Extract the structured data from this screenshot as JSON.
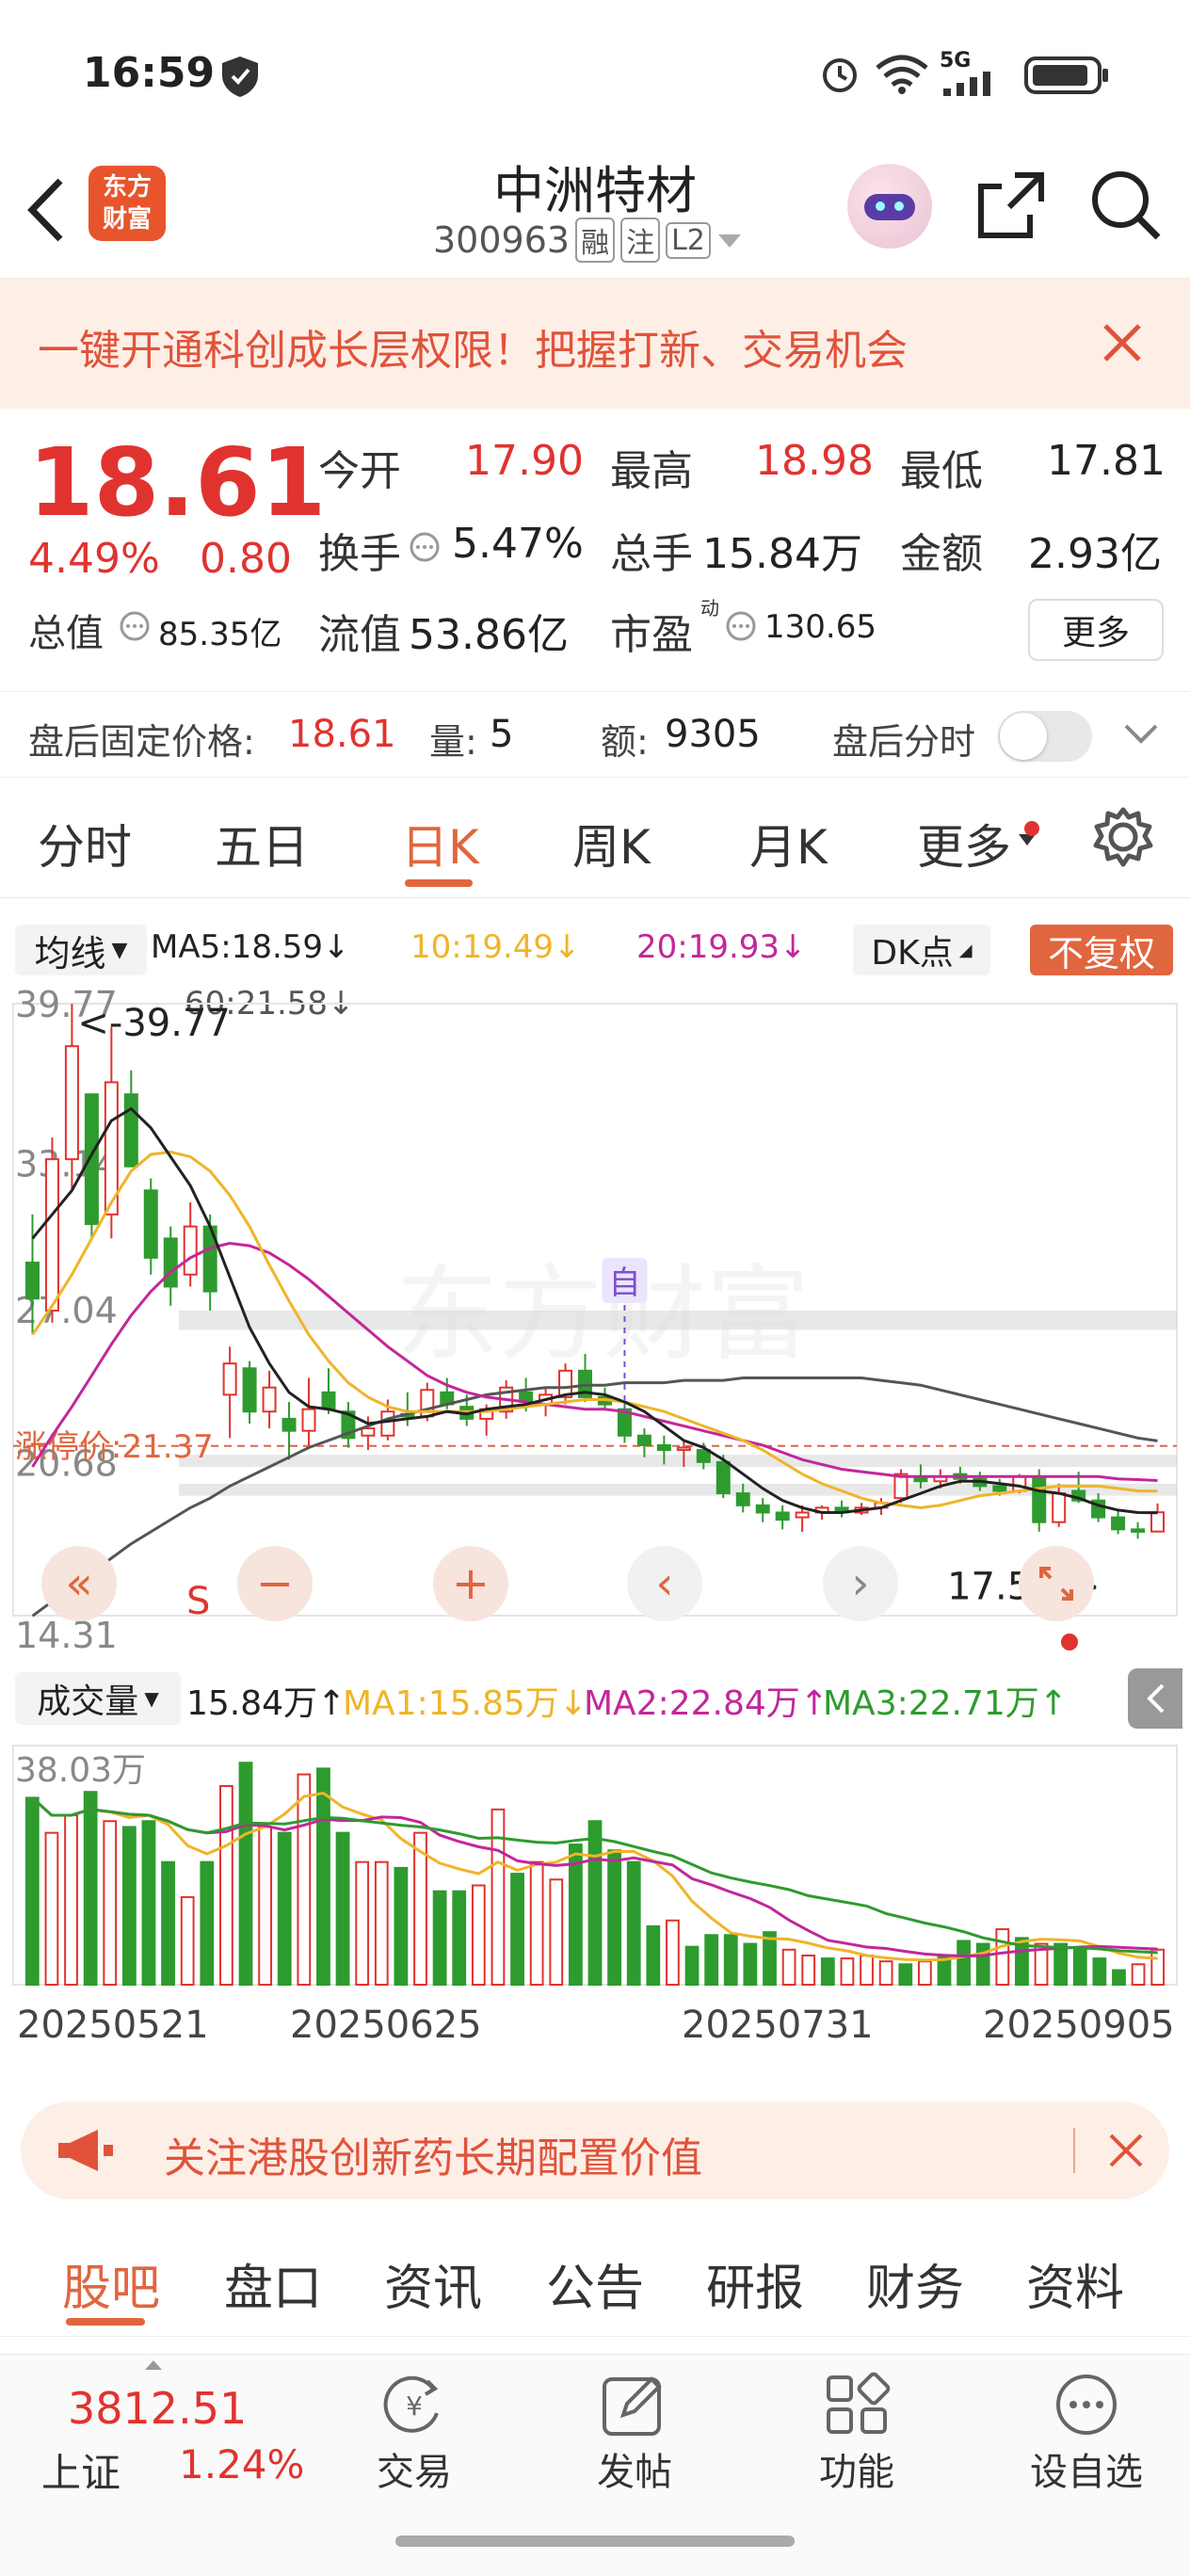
{
  "status": {
    "time": "16:59",
    "net": "5G"
  },
  "header": {
    "name": "中洲特材",
    "code": "300963",
    "tags": [
      "融",
      "注",
      "L2"
    ],
    "logo_lines": [
      "东方",
      "财富"
    ]
  },
  "promo": {
    "text": "一键开通科创成长层权限！把握打新、交易机会"
  },
  "quote": {
    "price": "18.61",
    "pct": "4.49%",
    "chg": "0.80",
    "open_l": "今开",
    "open": "17.90",
    "high_l": "最高",
    "high": "18.98",
    "low_l": "最低",
    "low": "17.81",
    "turn_l": "换手",
    "turn": "5.47%",
    "vol_l": "总手",
    "vol": "15.84万",
    "amt_l": "金额",
    "amt": "2.93亿",
    "mcap_l": "总值",
    "mcap": "85.35亿",
    "flt_l": "流值",
    "flt": "53.86亿",
    "pe_l": "市盈",
    "pe_sup": "动",
    "pe": "130.65",
    "more": "更多"
  },
  "after": {
    "price_l": "盘后固定价格:",
    "price": "18.61",
    "vol_l": "量:",
    "vol": "5",
    "amt_l": "额:",
    "amt": "9305",
    "tl_l": "盘后分时"
  },
  "tabs": [
    "分时",
    "五日",
    "日K",
    "周K",
    "月K",
    "更多"
  ],
  "ma": {
    "btn": "均线",
    "ma5": "MA5:18.59↓",
    "ma10": "10:19.49↓",
    "ma20": "20:19.93↓",
    "ma60": "60:21.58↓",
    "dk": "DK点",
    "fq": "不复权"
  },
  "colors": {
    "up": "#e0332f",
    "down": "#2e9b2e",
    "ma5": "#222222",
    "ma10": "#f0b429",
    "ma20": "#c2279a",
    "ma60": "#555555",
    "accent": "#e0663f"
  },
  "chart_labels": {
    "y_top": "39.77",
    "y_mid": "33.14",
    "y_27": "27.04",
    "y_20": "20.68",
    "y_low": "14.31",
    "max_mark": "<-39.77",
    "min_mark": "17.51->",
    "limit": "涨停价:21.37",
    "auto": "自",
    "s_mark": "S",
    "watermark": "东方财富"
  },
  "chart_data": [
    {
      "type": "candlestick",
      "title": "日K",
      "ylim": [
        14.31,
        39.77
      ],
      "ohlc": [
        [
          29,
          31,
          26,
          27.5
        ],
        [
          27,
          34.2,
          26.5,
          33.3
        ],
        [
          33.3,
          39.77,
          32,
          38
        ],
        [
          36,
          36,
          30,
          30.6
        ],
        [
          31,
          38.8,
          30,
          36.5
        ],
        [
          36,
          37,
          33,
          33
        ],
        [
          32,
          32.5,
          28.5,
          29.2
        ],
        [
          30,
          30.5,
          27.2,
          28
        ],
        [
          28.5,
          31.5,
          28,
          30.5
        ],
        [
          30.5,
          31,
          27,
          27.8
        ],
        [
          23.5,
          25.5,
          21.7,
          24.8
        ],
        [
          24.6,
          24.9,
          22.3,
          22.8
        ],
        [
          22.8,
          24.5,
          22.1,
          23.8
        ],
        [
          22.5,
          23.2,
          20.8,
          22
        ],
        [
          22,
          24.2,
          21.4,
          22.9
        ],
        [
          23.6,
          24.6,
          22.7,
          22.9
        ],
        [
          22.8,
          23.2,
          21.3,
          21.7
        ],
        [
          21.8,
          22.6,
          21.2,
          22.1
        ],
        [
          21.8,
          23.3,
          21.6,
          22.8
        ],
        [
          22.7,
          23.6,
          22.2,
          22.6
        ],
        [
          22.6,
          24,
          22.4,
          23.7
        ],
        [
          23.6,
          24.2,
          22.9,
          23.1
        ],
        [
          23,
          23.5,
          22.2,
          22.5
        ],
        [
          22.5,
          23.1,
          21.8,
          22.9
        ],
        [
          22.8,
          24.1,
          22.5,
          23.8
        ],
        [
          23.6,
          24.2,
          22.8,
          23.2
        ],
        [
          23.1,
          23.8,
          22.6,
          23.5
        ],
        [
          23.4,
          24.8,
          23.1,
          24.5
        ],
        [
          24.5,
          25.2,
          23.2,
          23.4
        ],
        [
          23.4,
          23.8,
          22.9,
          23.1
        ],
        [
          22.9,
          23.2,
          21.5,
          21.8
        ],
        [
          21.8,
          22.1,
          20.9,
          21.4
        ],
        [
          21.4,
          21.8,
          20.6,
          21.2
        ],
        [
          21.2,
          21.6,
          20.5,
          21.3
        ],
        [
          21.2,
          21.5,
          20.4,
          20.7
        ],
        [
          20.7,
          21,
          19.2,
          19.4
        ],
        [
          19.4,
          19.8,
          18.6,
          18.9
        ],
        [
          18.9,
          19.2,
          18.2,
          18.6
        ],
        [
          18.6,
          18.9,
          17.9,
          18.3
        ],
        [
          18.4,
          18.9,
          17.8,
          18.6
        ],
        [
          18.6,
          18.9,
          18.3,
          18.8
        ],
        [
          18.8,
          19.1,
          18.4,
          18.6
        ],
        [
          18.6,
          19,
          18.5,
          18.8
        ],
        [
          18.8,
          19.2,
          18.5,
          19
        ],
        [
          19.2,
          20.4,
          19,
          20.2
        ],
        [
          20.1,
          20.6,
          19.6,
          19.9
        ],
        [
          19.9,
          20.4,
          19.6,
          20.1
        ],
        [
          20.2,
          20.5,
          19.8,
          20
        ],
        [
          20,
          20.3,
          19.5,
          19.7
        ],
        [
          19.7,
          20,
          19.3,
          19.5
        ],
        [
          19.5,
          20.2,
          19.4,
          20.1
        ],
        [
          20.1,
          20.4,
          17.8,
          18.2
        ],
        [
          18.2,
          19.8,
          18,
          19.4
        ],
        [
          19.5,
          20.3,
          19,
          19.1
        ],
        [
          19.1,
          19.4,
          18.2,
          18.4
        ],
        [
          18.4,
          18.7,
          17.7,
          17.9
        ],
        [
          17.9,
          18.2,
          17.51,
          17.8
        ],
        [
          17.81,
          18.98,
          17.81,
          18.61
        ]
      ],
      "ma5": [
        30,
        31,
        32,
        33.5,
        34.9,
        35.4,
        34.6,
        33.4,
        32.2,
        30.5,
        28.4,
        26.3,
        24.8,
        23.6,
        23,
        22.9,
        22.7,
        22.3,
        22.4,
        22.5,
        22.6,
        22.8,
        22.7,
        22.9,
        23,
        23.1,
        23.3,
        23.5,
        23.6,
        23.5,
        23.2,
        22.8,
        22.2,
        21.6,
        21.3,
        20.8,
        20.2,
        19.6,
        19.1,
        18.8,
        18.6,
        18.6,
        18.7,
        18.8,
        19.1,
        19.4,
        19.7,
        19.9,
        19.9,
        19.8,
        19.7,
        19.5,
        19.4,
        19.2,
        18.9,
        18.7,
        18.6,
        18.59
      ],
      "ma10": [
        26,
        27.2,
        28.5,
        30,
        31.5,
        32.8,
        33.5,
        33.6,
        33.4,
        32.8,
        31.8,
        30.5,
        28.9,
        27.4,
        26,
        24.9,
        24,
        23.4,
        23,
        22.8,
        22.8,
        22.8,
        22.8,
        22.8,
        22.9,
        23,
        23.1,
        23.2,
        23.3,
        23.3,
        23.2,
        23,
        22.8,
        22.5,
        22.2,
        21.9,
        21.6,
        21.2,
        20.7,
        20.2,
        19.8,
        19.5,
        19.2,
        19,
        18.9,
        18.8,
        18.9,
        19.1,
        19.3,
        19.4,
        19.5,
        19.6,
        19.7,
        19.7,
        19.7,
        19.6,
        19.5,
        19.49
      ],
      "ma20": [
        20.5,
        21.8,
        23,
        24.3,
        25.6,
        26.8,
        27.8,
        28.6,
        29.2,
        29.6,
        29.8,
        29.7,
        29.4,
        28.9,
        28.3,
        27.6,
        26.9,
        26.2,
        25.5,
        24.9,
        24.3,
        23.9,
        23.6,
        23.4,
        23.3,
        23.2,
        23.1,
        23,
        22.9,
        22.9,
        22.8,
        22.6,
        22.4,
        22.2,
        22,
        21.8,
        21.6,
        21.4,
        21.1,
        20.8,
        20.6,
        20.4,
        20.3,
        20.2,
        20.1,
        20.1,
        20.1,
        20.1,
        20.1,
        20.1,
        20.1,
        20.1,
        20.1,
        20.1,
        20.1,
        20,
        19.97,
        19.93
      ],
      "ma60": [
        14.3,
        14.9,
        15.5,
        16.1,
        16.7,
        17.3,
        17.8,
        18.3,
        18.8,
        19.2,
        19.7,
        20.1,
        20.5,
        20.9,
        21.3,
        21.6,
        21.9,
        22.2,
        22.5,
        22.7,
        22.9,
        23.1,
        23.3,
        23.5,
        23.6,
        23.7,
        23.8,
        23.8,
        23.9,
        23.9,
        24,
        24,
        24,
        24.1,
        24.1,
        24.1,
        24.2,
        24.2,
        24.2,
        24.2,
        24.2,
        24.2,
        24.2,
        24.1,
        24,
        23.9,
        23.7,
        23.5,
        23.3,
        23.1,
        22.9,
        22.7,
        22.5,
        22.3,
        22.1,
        21.9,
        21.7,
        21.58
      ]
    },
    {
      "type": "bar",
      "title": "成交量",
      "series_label": "成交量",
      "ylim": [
        0,
        38.03
      ],
      "unit": "万",
      "dates_shown": [
        "20250521",
        "20250625",
        "20250731",
        "20250905"
      ],
      "values": [
        32,
        26,
        29,
        33,
        28,
        27,
        28,
        21,
        15,
        21,
        34,
        38,
        27,
        26,
        36,
        37,
        26,
        21,
        21,
        20,
        26,
        16,
        16,
        17,
        30,
        19,
        21,
        18,
        24,
        28,
        23,
        21,
        10,
        11,
        6.5,
        8.5,
        8.5,
        7,
        9,
        6,
        5,
        4.5,
        4.5,
        5,
        4,
        3.5,
        4,
        5,
        7.5,
        7,
        9.5,
        8,
        7,
        7,
        6,
        4.5,
        2.5,
        3.5,
        6
      ],
      "ma1": "MA1:15.85万↓",
      "ma2": "MA2:22.84万↑",
      "ma3": "MA3:22.71万↑",
      "vol": "15.84万↑",
      "max_label": "38.03万",
      "btn": "成交量"
    }
  ],
  "banner": {
    "text": "关注港股创新药长期配置价值"
  },
  "subtabs": [
    "股吧",
    "盘口",
    "资讯",
    "公告",
    "研报",
    "财务",
    "资料"
  ],
  "bottom": {
    "index_val": "3812.51",
    "index_name": "上证",
    "index_pct": "1.24%",
    "items": [
      "交易",
      "发帖",
      "功能",
      "设自选"
    ]
  }
}
